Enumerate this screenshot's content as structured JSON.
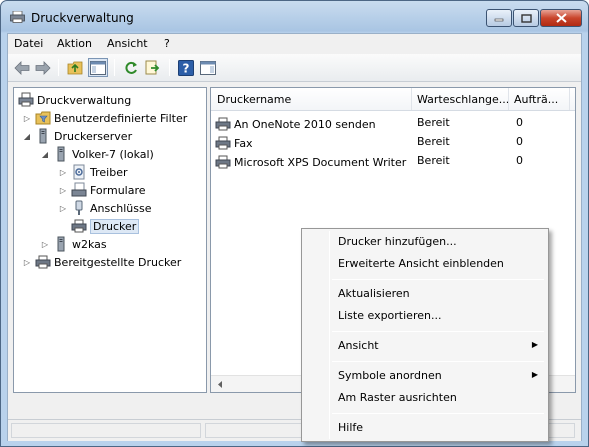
{
  "window": {
    "title": "Druckverwaltung"
  },
  "menubar": {
    "items": [
      "Datei",
      "Aktion",
      "Ansicht",
      "?"
    ]
  },
  "toolbar": {
    "buttons": [
      "back-icon",
      "forward-icon",
      "up-folder-icon",
      "console-tree-icon",
      "refresh-icon",
      "export-icon",
      "help-icon",
      "action-pane-icon"
    ]
  },
  "tree": {
    "items": [
      {
        "label": "Druckverwaltung",
        "icon": "print-management-icon"
      },
      {
        "label": "Benutzerdefinierte Filter",
        "icon": "filter-folder-icon"
      },
      {
        "label": "Druckerserver",
        "icon": "server-icon"
      },
      {
        "label": "Volker-7 (lokal)",
        "icon": "computer-icon"
      },
      {
        "label": "Treiber",
        "icon": "driver-icon"
      },
      {
        "label": "Formulare",
        "icon": "forms-icon"
      },
      {
        "label": "Anschlüsse",
        "icon": "port-icon"
      },
      {
        "label": "Drucker",
        "icon": "printer-icon"
      },
      {
        "label": "w2kas",
        "icon": "computer-icon"
      },
      {
        "label": "Bereitgestellte Drucker",
        "icon": "printer-icon"
      }
    ]
  },
  "list": {
    "columns": [
      "Druckername",
      "Warteschlange...",
      "Aufträ..."
    ],
    "rows": [
      {
        "name": "An OneNote 2010 senden",
        "status": "Bereit",
        "jobs": "0"
      },
      {
        "name": "Fax",
        "status": "Bereit",
        "jobs": "0"
      },
      {
        "name": "Microsoft XPS Document Writer",
        "status": "Bereit",
        "jobs": "0"
      }
    ]
  },
  "context_menu": {
    "items": [
      {
        "label": "Drucker hinzufügen...",
        "submenu": false
      },
      {
        "label": "Erweiterte Ansicht einblenden",
        "submenu": false
      },
      {
        "label": "Aktualisieren",
        "submenu": false
      },
      {
        "label": "Liste exportieren...",
        "submenu": false
      },
      {
        "label": "Ansicht",
        "submenu": true
      },
      {
        "label": "Symbole anordnen",
        "submenu": true
      },
      {
        "label": "Am Raster ausrichten",
        "submenu": false
      },
      {
        "label": "Hilfe",
        "submenu": false
      }
    ]
  },
  "colors": {
    "title_gradient_top": "#c9dcef",
    "selection": "#dde8f5",
    "close_button": "#c9452c"
  }
}
